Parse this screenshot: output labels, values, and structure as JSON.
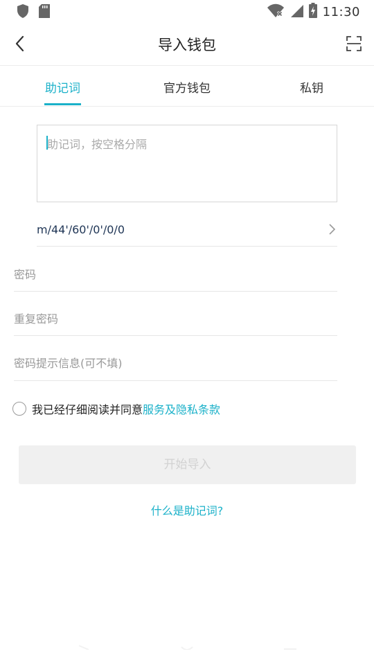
{
  "status_bar": {
    "time": "11:30",
    "icons": [
      "shield-icon",
      "sd-card-icon",
      "wifi-off-icon",
      "signal-icon",
      "battery-charging-icon"
    ]
  },
  "header": {
    "title": "导入钱包",
    "back_icon": "chevron-left-icon",
    "scan_icon": "scan-icon"
  },
  "tabs": [
    {
      "label": "助记词",
      "active": true
    },
    {
      "label": "官方钱包",
      "active": false
    },
    {
      "label": "私钥",
      "active": false
    }
  ],
  "mnemonic": {
    "placeholder": "助记词，按空格分隔",
    "value": ""
  },
  "derivation_path": {
    "value": "m/44'/60'/0'/0/0"
  },
  "fields": {
    "password_placeholder": "密码",
    "repeat_password_placeholder": "重复密码",
    "hint_placeholder": "密码提示信息(可不填)"
  },
  "agreement": {
    "text": "我已经仔细阅读并同意",
    "link": "服务及隐私条款",
    "checked": false
  },
  "import_button": {
    "label": "开始导入",
    "enabled": false
  },
  "help_link": "什么是助记词?",
  "colors": {
    "accent": "#1bb1c9",
    "disabled_button_bg": "#f0f0f0",
    "disabled_button_text": "#d2d2d2"
  }
}
